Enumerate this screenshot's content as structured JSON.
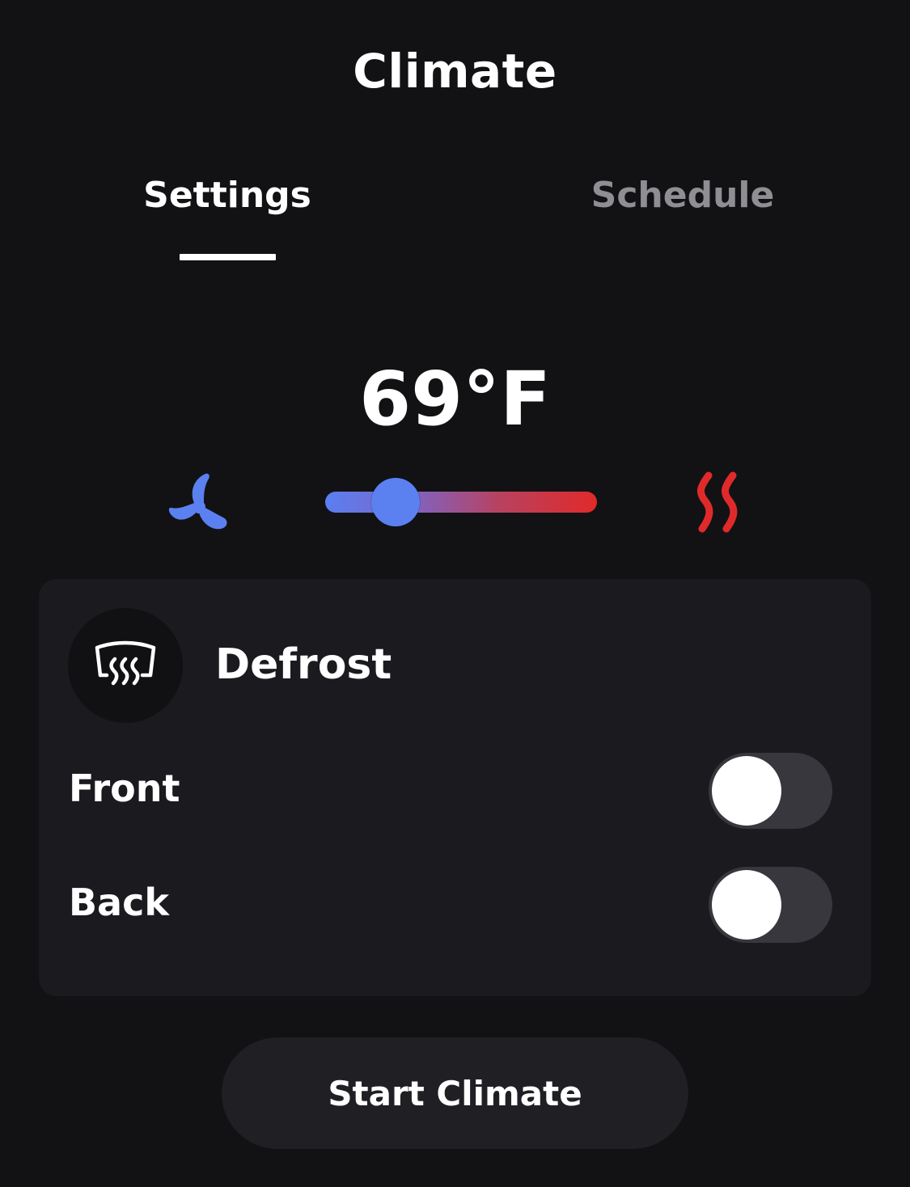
{
  "header": {
    "title": "Climate"
  },
  "tabs": [
    {
      "label": "Settings",
      "active": true
    },
    {
      "label": "Schedule",
      "active": false
    }
  ],
  "temperature": {
    "value_label": "69°F",
    "slider_fraction": 0.21
  },
  "icons": {
    "cool": "fan-icon",
    "heat": "heat-waves-icon",
    "defrost": "windshield-defrost-icon"
  },
  "defrost": {
    "title": "Defrost",
    "options": [
      {
        "label": "Front",
        "on": false
      },
      {
        "label": "Back",
        "on": false
      }
    ]
  },
  "actions": {
    "start_label": "Start Climate"
  },
  "colors": {
    "background": "#121215",
    "card": "#1a1a1f",
    "cool_blue": "#5b81f0",
    "heat_red": "#e02a2a",
    "tab_inactive": "#8e8e93",
    "toggle_off": "#37373d"
  }
}
